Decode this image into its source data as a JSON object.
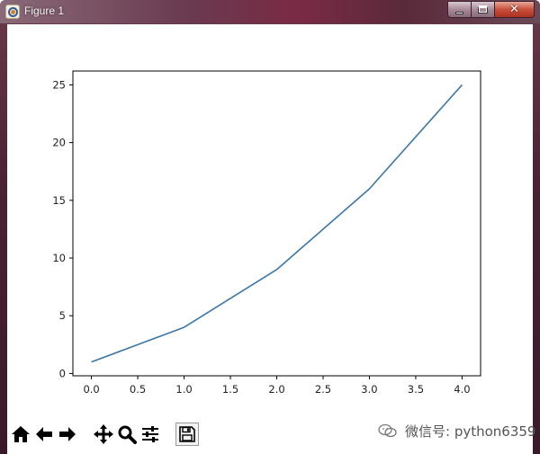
{
  "window": {
    "title": "Figure 1",
    "close_glyph": "✕"
  },
  "toolbar": {
    "buttons": [
      {
        "icon": "home-icon"
      },
      {
        "icon": "arrow-left-icon"
      },
      {
        "icon": "arrow-right-icon"
      },
      {
        "icon": "move-icon"
      },
      {
        "icon": "zoom-icon"
      },
      {
        "icon": "sliders-icon"
      },
      {
        "icon": "save-icon"
      }
    ]
  },
  "watermark": {
    "text": "微信号: python6359",
    "icon": "wechat-icon"
  },
  "colors": {
    "line": "#3a76a8",
    "axes": "#000000"
  },
  "chart_data": {
    "type": "line",
    "title": "",
    "xlabel": "",
    "ylabel": "",
    "x": [
      0,
      1,
      2,
      3,
      4
    ],
    "series": [
      {
        "values": [
          1,
          4,
          9,
          16,
          25
        ]
      }
    ],
    "xlim": [
      -0.2,
      4.2
    ],
    "ylim": [
      -0.2,
      26.2
    ],
    "xticks": [
      0.0,
      0.5,
      1.0,
      1.5,
      2.0,
      2.5,
      3.0,
      3.5,
      4.0
    ],
    "xtick_labels": [
      "0.0",
      "0.5",
      "1.0",
      "1.5",
      "2.0",
      "2.5",
      "3.0",
      "3.5",
      "4.0"
    ],
    "yticks": [
      0,
      5,
      10,
      15,
      20,
      25
    ],
    "ytick_labels": [
      "0",
      "5",
      "10",
      "15",
      "20",
      "25"
    ],
    "grid": false
  }
}
